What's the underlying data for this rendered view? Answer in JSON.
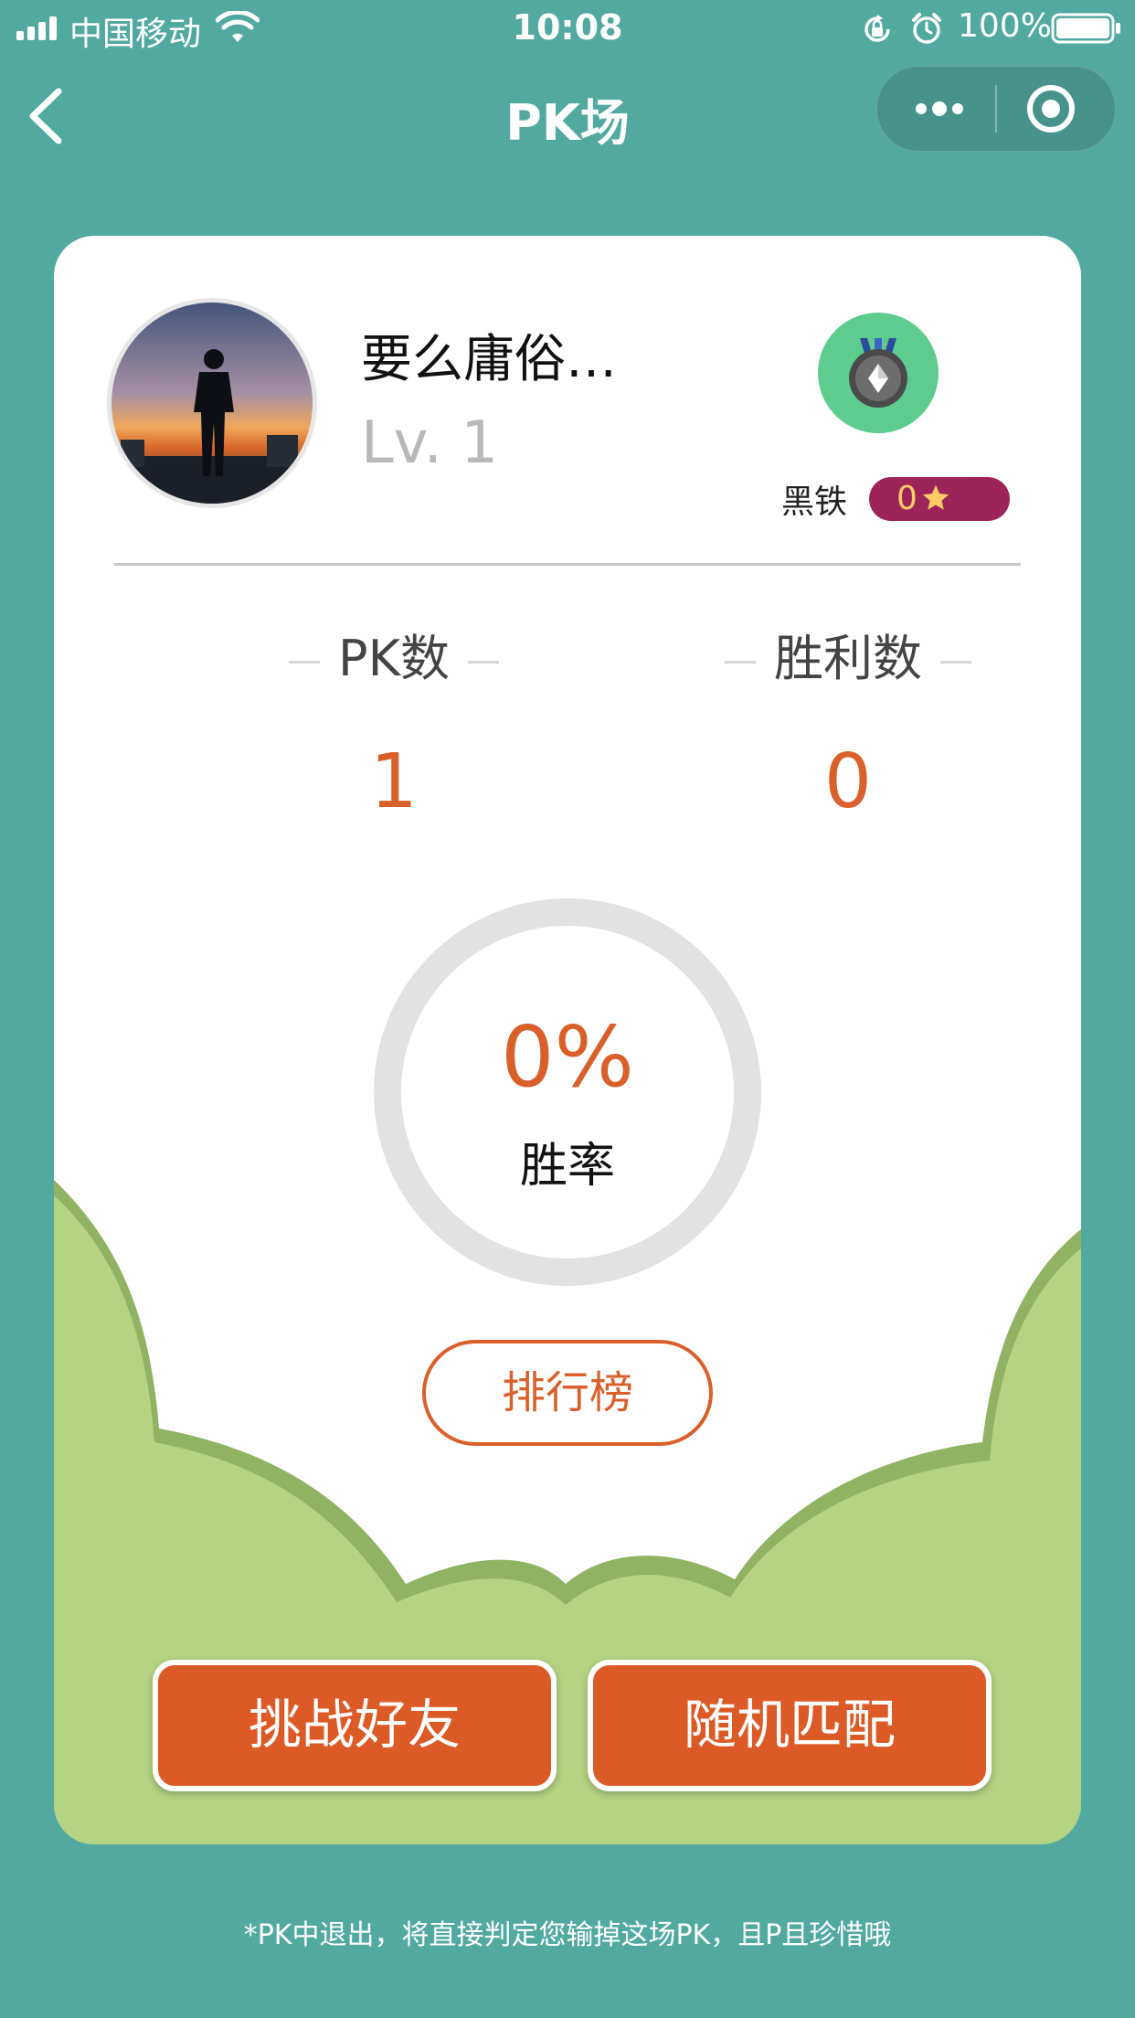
{
  "status_bar": {
    "carrier": "中国移动",
    "time": "10:08",
    "battery": "100%"
  },
  "nav": {
    "title": "PK场"
  },
  "profile": {
    "username": "要么庸俗…",
    "level": "Lv. 1",
    "rank_name": "黑铁",
    "stars": "0"
  },
  "stats": {
    "pk_label": "PK数",
    "pk_value": "1",
    "win_label": "胜利数",
    "win_value": "0",
    "win_rate": "0%",
    "win_rate_label": "胜率",
    "win_rate_fraction": 0
  },
  "buttons": {
    "leaderboard": "排行榜",
    "challenge_friend": "挑战好友",
    "random_match": "随机匹配"
  },
  "footer": {
    "note": "*PK中退出，将直接判定您输掉这场PK，且P且珍惜哦"
  },
  "colors": {
    "background": "#52a9a0",
    "accent": "#d95f2b",
    "hill_green": "#b4d383",
    "rank_badge": "#5dcc8e",
    "star_pill": "#9c2458"
  },
  "icons": {
    "back": "chevron-left-icon",
    "more": "more-dots-icon",
    "close": "target-circle-icon",
    "rank": "iron-medal-icon",
    "star": "star-icon"
  }
}
